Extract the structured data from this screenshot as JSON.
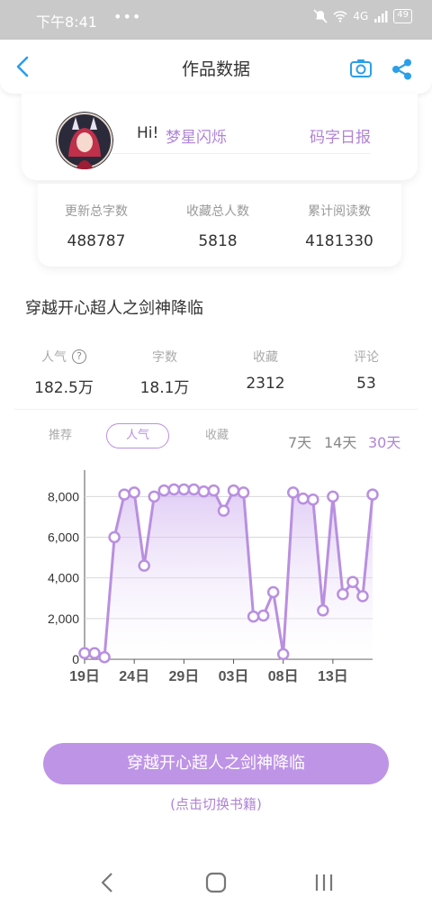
{
  "status_bar": {
    "time": "下午8:41",
    "dots": "•••",
    "network": "4G",
    "battery": "49"
  },
  "header": {
    "title": "作品数据",
    "back_icon": "back-arrow-icon",
    "camera_icon": "camera-icon",
    "share_icon": "share-icon"
  },
  "profile": {
    "greeting": "Hi!",
    "username": "梦星闪烁",
    "daily_report": "码字日报",
    "avatar_icon": "avatar"
  },
  "stats": [
    {
      "label": "更新总字数",
      "value": "488787"
    },
    {
      "label": "收藏总人数",
      "value": "5818"
    },
    {
      "label": "累计阅读数",
      "value": "4181330"
    }
  ],
  "book": {
    "title": "穿越开心超人之剑神降临"
  },
  "metrics": [
    {
      "label": "人气",
      "value": "182.5万",
      "has_help": true
    },
    {
      "label": "字数",
      "value": "18.1万"
    },
    {
      "label": "收藏",
      "value": "2312"
    },
    {
      "label": "评论",
      "value": "53"
    }
  ],
  "tabs": [
    {
      "label": "推荐",
      "active": false
    },
    {
      "label": "人气",
      "active": true
    },
    {
      "label": "收藏",
      "active": false
    }
  ],
  "ranges": [
    {
      "label": "7天",
      "active": false
    },
    {
      "label": "14天",
      "active": false
    },
    {
      "label": "30天",
      "active": true
    }
  ],
  "chart_data": {
    "type": "area",
    "x_ticks": [
      "19日",
      "24日",
      "29日",
      "03日",
      "08日",
      "13日"
    ],
    "y_ticks": [
      "0",
      "2,000",
      "4,000",
      "6,000",
      "8,000"
    ],
    "ylim": [
      0,
      9300
    ],
    "grid": true,
    "color": "#b98fe0",
    "x": [
      1,
      2,
      3,
      4,
      5,
      6,
      7,
      8,
      9,
      10,
      11,
      12,
      13,
      14,
      15,
      16,
      17,
      18,
      19,
      20,
      21,
      22,
      23,
      24,
      25,
      26,
      27,
      28,
      29,
      30
    ],
    "values": [
      300,
      300,
      100,
      6000,
      8100,
      8200,
      4600,
      8000,
      8300,
      8350,
      8350,
      8350,
      8250,
      8300,
      7300,
      8300,
      8200,
      2100,
      2150,
      3300,
      250,
      8200,
      7900,
      7850,
      2400,
      8000,
      3200,
      3800,
      3100,
      8100
    ]
  },
  "switch_button": {
    "label": "穿越开心超人之剑神降临",
    "hint": "(点击切换书籍)"
  },
  "system_nav": {
    "back_icon": "system-back-icon",
    "home_icon": "system-home-icon",
    "recent_icon": "system-recent-apps-icon"
  }
}
